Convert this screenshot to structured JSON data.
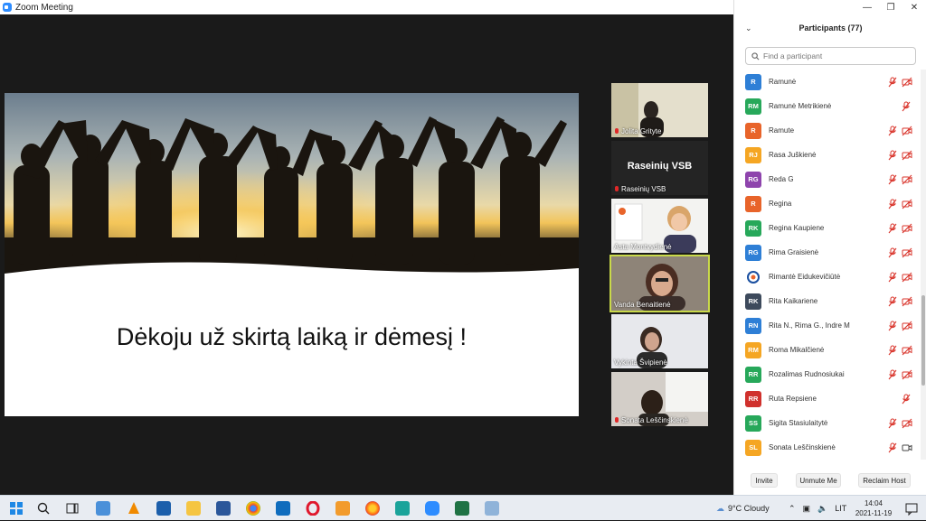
{
  "window": {
    "title": "Zoom Meeting"
  },
  "slide": {
    "text": "Dėkoju už skirtą laiką ir dėmesį !"
  },
  "thumbnails": [
    {
      "name": "Jolita Grityte",
      "type": "video",
      "muted": true
    },
    {
      "name": "Raseinių VSB",
      "type": "text",
      "bigtext": "Raseinių VSB",
      "muted": true
    },
    {
      "name": "Asta Montvydienė",
      "type": "video",
      "muted": false
    },
    {
      "name": "Vanda Benaitienė",
      "type": "video",
      "muted": false,
      "active": true
    },
    {
      "name": "Vykinta Švipienė",
      "type": "video",
      "muted": false
    },
    {
      "name": "Sonata Leščinskienė",
      "type": "video",
      "muted": true
    }
  ],
  "panel": {
    "title": "Participants (77)",
    "search_placeholder": "Find a participant",
    "participants": [
      {
        "initials": "R",
        "name": "Ramunė",
        "color": "#2e7fd6",
        "mic": "muted",
        "cam": "off"
      },
      {
        "initials": "RM",
        "name": "Ramunė Metrikienė",
        "color": "#27a85a",
        "mic": "muted",
        "cam": "none"
      },
      {
        "initials": "R",
        "name": "Ramute",
        "color": "#e8642a",
        "mic": "muted",
        "cam": "off"
      },
      {
        "initials": "RJ",
        "name": "Rasa Juškienė",
        "color": "#f5a623",
        "mic": "muted",
        "cam": "off"
      },
      {
        "initials": "RG",
        "name": "Reda G",
        "color": "#8e44ad",
        "mic": "muted",
        "cam": "off"
      },
      {
        "initials": "R",
        "name": "Regina",
        "color": "#e8642a",
        "mic": "muted",
        "cam": "off"
      },
      {
        "initials": "RK",
        "name": "Regina Kaupiene",
        "color": "#27a85a",
        "mic": "muted",
        "cam": "off"
      },
      {
        "initials": "RG",
        "name": "Rima Graisienė",
        "color": "#2e7fd6",
        "mic": "muted",
        "cam": "off"
      },
      {
        "initials": "",
        "name": "Rimantė Eidukevičiūtė",
        "color": "logo",
        "mic": "muted",
        "cam": "off"
      },
      {
        "initials": "RK",
        "name": "Rita Kaikariene",
        "color": "#3d4a5c",
        "mic": "muted",
        "cam": "off"
      },
      {
        "initials": "RN",
        "name": "Rita N., Rima G., Indre M",
        "color": "#2e7fd6",
        "mic": "muted",
        "cam": "off"
      },
      {
        "initials": "RM",
        "name": "Roma Mikalčienė",
        "color": "#f5a623",
        "mic": "muted",
        "cam": "off"
      },
      {
        "initials": "RR",
        "name": "Rozalimas Rudnosiukai",
        "color": "#27a85a",
        "mic": "muted",
        "cam": "off"
      },
      {
        "initials": "RR",
        "name": "Ruta Repsiene",
        "color": "#d0312d",
        "mic": "muted",
        "cam": "none"
      },
      {
        "initials": "SS",
        "name": "Sigita Stasiulaitytė",
        "color": "#27a85a",
        "mic": "muted",
        "cam": "off"
      },
      {
        "initials": "SL",
        "name": "Sonata Leščinskienė",
        "color": "#f5a623",
        "mic": "muted",
        "cam": "on"
      }
    ],
    "buttons": {
      "invite": "Invite",
      "unmute": "Unmute Me",
      "reclaim": "Reclaim Host"
    }
  },
  "taskbar": {
    "weather": "9°C Cloudy",
    "language": "LIT",
    "time": "14:04",
    "date": "2021-11-19"
  }
}
